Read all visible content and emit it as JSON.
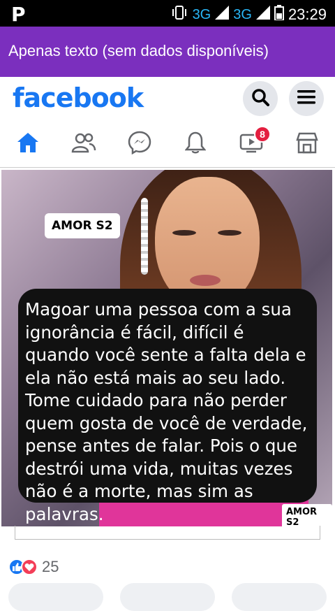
{
  "status_bar": {
    "left_glyph": "P",
    "network1": "3G",
    "network2": "3G",
    "network2_sup": "3G",
    "time": "23:29"
  },
  "app_bar": {
    "title": "Apenas texto (sem dados disponíveis)"
  },
  "facebook": {
    "logo": "facebook",
    "nav_badge_count": "8"
  },
  "post": {
    "tag_top": "AMOR S2",
    "tag_bottom": "AMOR S2",
    "quote": "Magoar uma pessoa com a sua ignorância é fácil, difícil é quando você sente a falta dela e ela não está mais ao seu lado. Tome cuidado para não perder quem gosta de você de verdade, pense antes de falar. Pois o que destrói uma vida, muitas vezes não é a morte, mas sim as palavras.",
    "reaction_count": "25"
  },
  "colors": {
    "status_bar": "#000000",
    "app_bar": "#7b2fbe",
    "facebook_blue": "#1877f2",
    "badge_red": "#e41e3f",
    "love_red": "#f33e58"
  }
}
